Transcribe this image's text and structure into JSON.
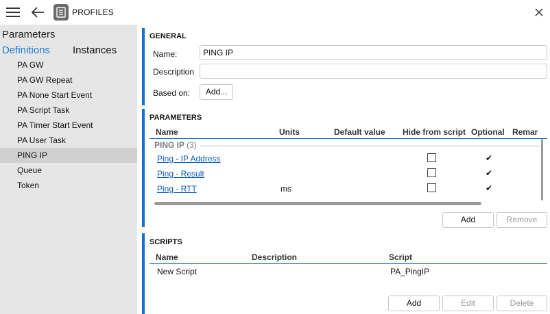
{
  "titlebar": {
    "title": "PROFILES"
  },
  "sidebar": {
    "heading": "Parameters",
    "tabs": [
      {
        "label": "Definitions",
        "active": true
      },
      {
        "label": "Instances",
        "active": false
      }
    ],
    "items": [
      {
        "label": "PA GW"
      },
      {
        "label": "PA GW Repeat"
      },
      {
        "label": "PA None Start Event"
      },
      {
        "label": "PA Script Task"
      },
      {
        "label": "PA Timer Start Event"
      },
      {
        "label": "PA User Task"
      },
      {
        "label": "PING IP",
        "selected": true
      },
      {
        "label": "Queue"
      },
      {
        "label": "Token"
      }
    ]
  },
  "general": {
    "title": "GENERAL",
    "name_label": "Name:",
    "name_value": "PING IP",
    "description_label": "Description",
    "description_value": "",
    "based_on_label": "Based on:",
    "add_button": "Add..."
  },
  "parameters": {
    "title": "PARAMETERS",
    "columns": [
      "Name",
      "Units",
      "Default value",
      "Hide from script",
      "Optional",
      "Remar"
    ],
    "group": {
      "name": "PING IP",
      "count": "(3)"
    },
    "rows": [
      {
        "name": "Ping - IP Address",
        "units": "",
        "default": "",
        "hide": false,
        "optional": "✔"
      },
      {
        "name": "Ping - Result",
        "units": "",
        "default": "",
        "hide": false,
        "optional": "✔"
      },
      {
        "name": "Ping - RTT",
        "units": "ms",
        "default": "",
        "hide": false,
        "optional": "✔"
      }
    ],
    "add_button": "Add",
    "remove_button": "Remove"
  },
  "scripts": {
    "title": "SCRIPTS",
    "columns": [
      "Name",
      "Description",
      "Script"
    ],
    "rows": [
      {
        "name": "New Script",
        "description": "",
        "script": "PA_PingIP"
      }
    ],
    "add_button": "Add",
    "edit_button": "Edit",
    "delete_button": "Delete"
  },
  "colors": {
    "accent": "#1a6fc7",
    "link": "#0b5db8",
    "sidebar_bg": "#e6e6e6",
    "selected_bg": "#d0d0d0"
  }
}
